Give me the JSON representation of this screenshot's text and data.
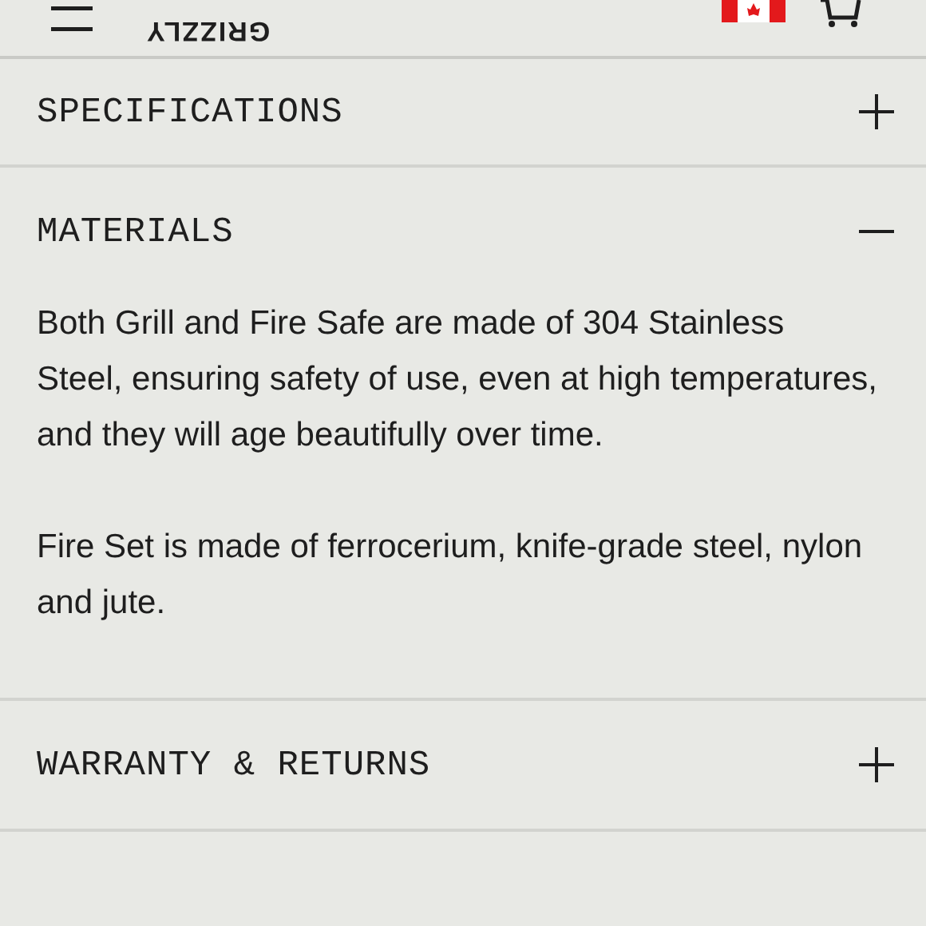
{
  "header": {
    "logo": "GRIZZLY"
  },
  "sections": [
    {
      "title": "SPECIFICATIONS",
      "expanded": false
    },
    {
      "title": "MATERIALS",
      "expanded": true,
      "paragraphs": [
        "Both Grill and Fire Safe are made of 304 Stainless Steel, ensuring safety of use, even at high temperatures, and they will age beautifully over time.",
        "Fire Set is made of ferrocerium, knife-grade steel, nylon and jute."
      ]
    },
    {
      "title": "WARRANTY & RETURNS",
      "expanded": false
    }
  ]
}
